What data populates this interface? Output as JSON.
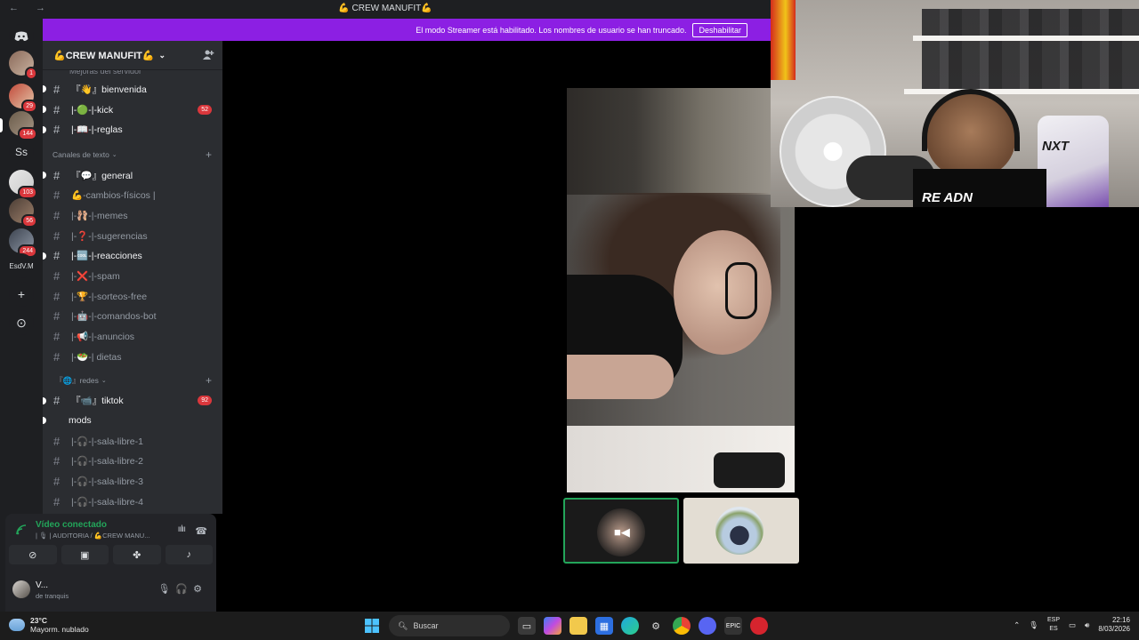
{
  "window": {
    "title": "💪 CREW MANUFIT💪",
    "nav_arrows": "← →"
  },
  "banner": {
    "message": "El modo Streamer está habilitado. Los nombres de usuario se han truncado.",
    "button": "Deshabilitar"
  },
  "rail": {
    "servers": [
      {
        "label": "",
        "badge": "1"
      },
      {
        "label": "",
        "badge": "29"
      },
      {
        "label": "",
        "badge": "144"
      },
      {
        "label": "Ss",
        "badge": ""
      },
      {
        "label": "",
        "badge": "103"
      },
      {
        "label": "",
        "badge": "56"
      },
      {
        "label": "",
        "badge": "244"
      },
      {
        "label": "EsdV.M",
        "badge": ""
      }
    ],
    "add_server": "+",
    "discover": "⊙"
  },
  "sidebar": {
    "server_name": "💪CREW MANUFIT💪",
    "cut_item": "Mejoras del servidor",
    "channels_top": [
      {
        "name": "『👋』bienvenida",
        "unread": true,
        "count": ""
      },
      {
        "name": "|-🟢-|-kick",
        "unread": true,
        "count": "52"
      },
      {
        "name": "|-📖-|-reglas",
        "unread": true,
        "count": ""
      }
    ],
    "category_text": "Canales de texto",
    "channels_text": [
      {
        "name": "『💬』general",
        "unread": true
      },
      {
        "name": "💪-cambios-físicos |",
        "unread": false
      },
      {
        "name": "|-🩰-|-memes",
        "unread": false
      },
      {
        "name": "|-❓-|-sugerencias",
        "unread": false
      },
      {
        "name": "|-🆒-|-reacciones",
        "unread": true
      },
      {
        "name": "|-❌-|-spam",
        "unread": false
      },
      {
        "name": "|-🏆-|-sorteos-free",
        "unread": false
      },
      {
        "name": "|-🤖-|-comandos-bot",
        "unread": false
      },
      {
        "name": "|-📢-|-anuncios",
        "unread": false
      },
      {
        "name": "|-🥗-| dietas",
        "unread": false
      }
    ],
    "category_redes": "『🌐』redes",
    "channels_redes": [
      {
        "name": "『📹』tiktok",
        "unread": true,
        "count": "92"
      }
    ],
    "folder": "mods",
    "channels_voice": [
      {
        "name": "|-🎧-|-sala-libre-1"
      },
      {
        "name": "|-🎧-|-sala-libre-2"
      },
      {
        "name": "|-🎧-|-sala-libre-3"
      },
      {
        "name": "|-🎧-|-sala-libre-4"
      }
    ]
  },
  "voice": {
    "status": "Vídeo conectado",
    "channel": "| 🎙 | AUDITORIA / 💪CREW MANU..."
  },
  "user": {
    "name": "V...",
    "status": "de tranquis"
  },
  "taskbar": {
    "temp": "23°C",
    "weather": "Mayorm. nublado",
    "search_placeholder": "Buscar",
    "lang_top": "ESP",
    "lang_bottom": "ES",
    "time": "22:16",
    "date": "8/03/2026"
  },
  "webcam": {
    "shirt_text": "RE ADN",
    "chair_text": "NXT"
  }
}
